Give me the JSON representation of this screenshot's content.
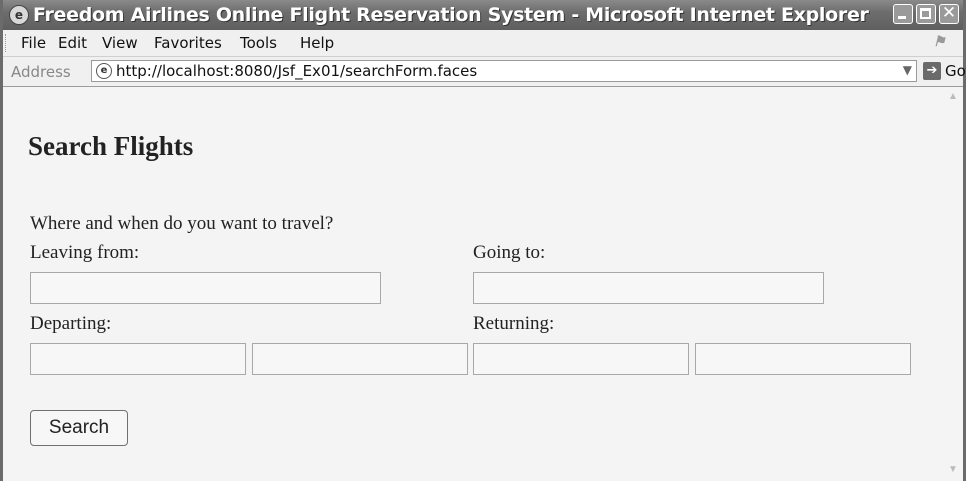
{
  "window": {
    "title": "Freedom Airlines Online Flight Reservation System - Microsoft Internet Explorer"
  },
  "menu": [
    "File",
    "Edit",
    "View",
    "Favorites",
    "Tools",
    "Help"
  ],
  "address": {
    "label": "Address",
    "url": "http://localhost:8080/Jsf_Ex01/searchForm.faces",
    "go_label": "Go"
  },
  "page": {
    "heading": "Search Flights",
    "prompt": "Where and when do you want to travel?",
    "leaving_label": "Leaving from:",
    "going_label": "Going to:",
    "departing_label": "Departing:",
    "returning_label": "Returning:",
    "fields": {
      "leaving_from": "",
      "going_to": "",
      "departing_date": "",
      "departing_time": "",
      "returning_date": "",
      "returning_time": ""
    },
    "search_button": "Search"
  },
  "icons": {
    "app": "internet-explorer-icon",
    "page": "ie-page-icon",
    "go": "go-arrow-icon",
    "dropdown": "chevron-down-icon"
  },
  "colors": {
    "titlebar": "#6d6d6d",
    "content_bg": "#f4f4f4",
    "field_border": "#a8a8a8"
  }
}
